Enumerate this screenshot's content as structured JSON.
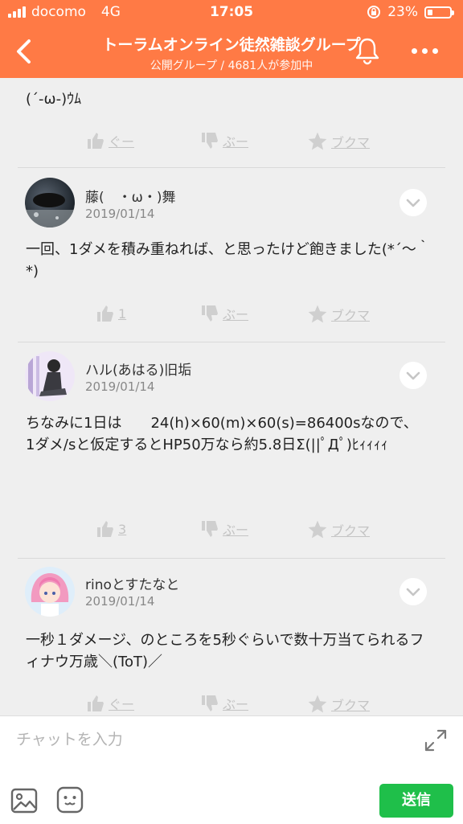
{
  "status_bar": {
    "carrier": "docomo",
    "network": "4G",
    "time": "17:05",
    "battery": "23%",
    "battery_level": 0.23
  },
  "header": {
    "title": "トーラムオンライン徒然雑談グループ",
    "subtitle": "公開グループ / 4681人が参加中",
    "back_icon": "chevron-left-icon",
    "bell_icon": "bell-icon",
    "more_icon": "more-dots-icon",
    "bg_color": "#ff7a45"
  },
  "posts": [
    {
      "message": "(´-ω-)ｳﾑ",
      "actions": {
        "like": "ぐー",
        "dislike": "ぶー",
        "bookmark": "ブクマ"
      }
    },
    {
      "username": "藤(　・ω・)舞",
      "date": "2019/01/14",
      "message": "一回、1ダメを積み重ねれば、と思ったけど飽きました(*´～｀*)",
      "actions": {
        "like": "1",
        "dislike": "ぶー",
        "bookmark": "ブクマ"
      }
    },
    {
      "username": "ハル(あはる)旧垢",
      "date": "2019/01/14",
      "message": "ちなみに1日は　　24(h)×60(m)×60(s)=86400sなので、\n1ダメ/sと仮定するとHP50万なら約5.8日Σ(||ﾟДﾟ)ﾋｨｨｨｨ",
      "actions": {
        "like": "3",
        "dislike": "ぶー",
        "bookmark": "ブクマ"
      }
    },
    {
      "username": "rinoとすたなと",
      "date": "2019/01/14",
      "message": "一秒１ダメージ、のところを5秒ぐらいで数十万当てられるフィナウ万歳＼(ToT)／",
      "actions": {
        "like": "ぐー",
        "dislike": "ぶー",
        "bookmark": "ブクマ"
      }
    }
  ],
  "input_bar": {
    "placeholder": "チャットを入力",
    "send_label": "送信",
    "expand_icon": "expand-icon",
    "image_icon": "image-icon",
    "emoji_icon": "emoji-icon",
    "send_color": "#1fbf4a"
  }
}
